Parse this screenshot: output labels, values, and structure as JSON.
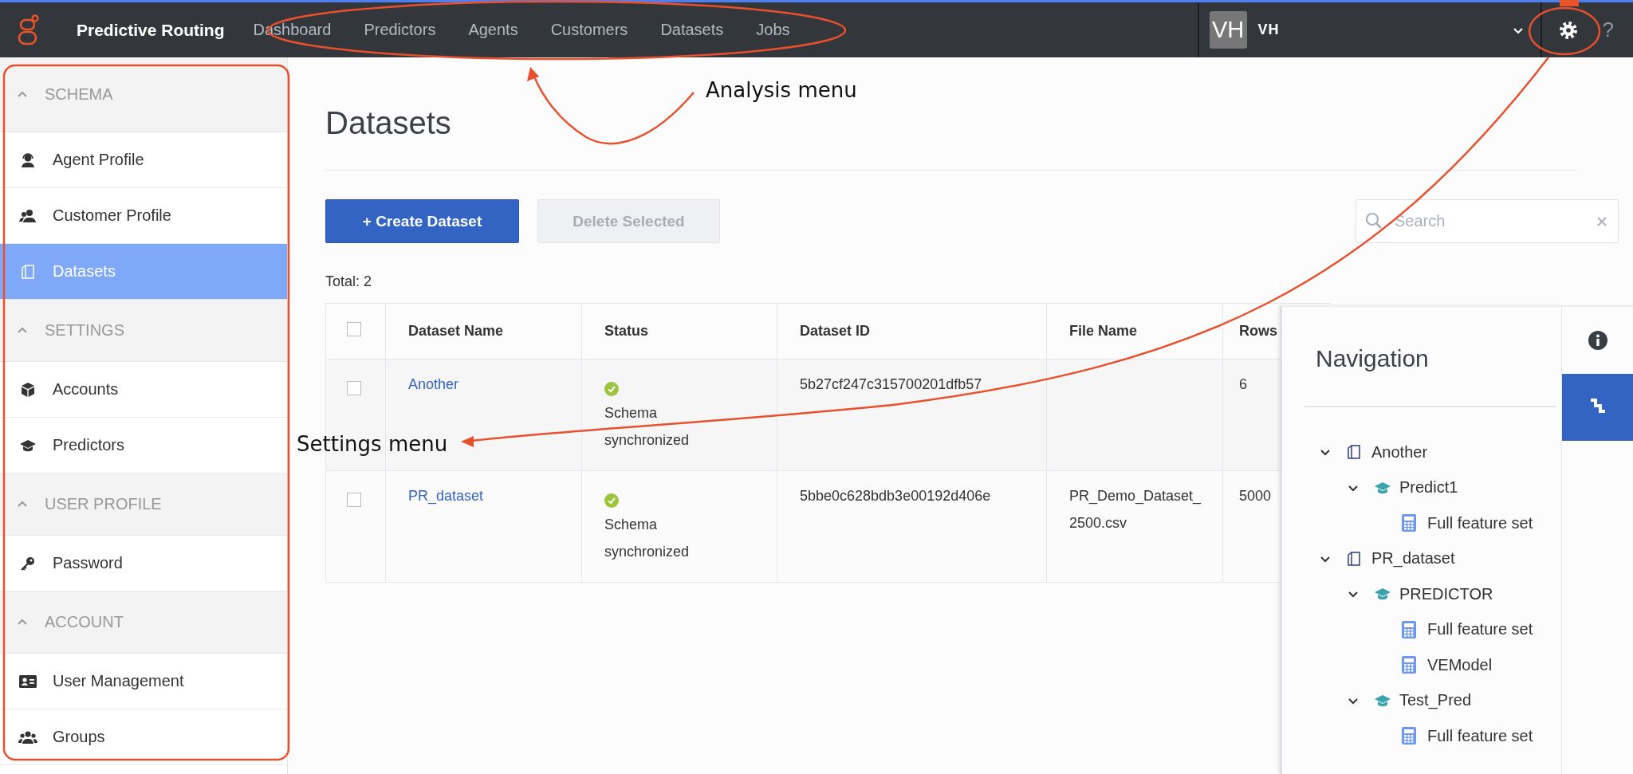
{
  "topbar": {
    "title": "Predictive Routing",
    "nav": [
      {
        "label": "Dashboard"
      },
      {
        "label": "Predictors"
      },
      {
        "label": "Agents"
      },
      {
        "label": "Customers"
      },
      {
        "label": "Datasets"
      },
      {
        "label": "Jobs"
      }
    ],
    "user": {
      "initials": "VH",
      "name": "VH"
    },
    "settings": {
      "selected": true
    },
    "help": "?"
  },
  "sidebar": {
    "sections": [
      {
        "title": "SCHEMA",
        "expanded": true,
        "items": [
          {
            "label": "Agent Profile",
            "kind": "agent",
            "selected": false
          },
          {
            "label": "Customer Profile",
            "kind": "customer",
            "selected": false
          },
          {
            "label": "Datasets",
            "kind": "dataset",
            "selected": true
          }
        ]
      },
      {
        "title": "SETTINGS",
        "expanded": true,
        "items": [
          {
            "label": "Accounts",
            "kind": "account",
            "selected": false
          },
          {
            "label": "Predictors",
            "kind": "predictor",
            "selected": false
          }
        ]
      },
      {
        "title": "USER PROFILE",
        "expanded": true,
        "items": [
          {
            "label": "Password",
            "kind": "password",
            "selected": false
          }
        ]
      },
      {
        "title": "ACCOUNT",
        "expanded": true,
        "items": [
          {
            "label": "User Management",
            "kind": "user-management",
            "selected": false
          },
          {
            "label": "Groups",
            "kind": "groups",
            "selected": false
          }
        ]
      }
    ]
  },
  "page": {
    "title": "Datasets",
    "buttons": [
      {
        "label": "+ Create Dataset",
        "kind": "primary",
        "disabled": false
      },
      {
        "label": "Delete Selected",
        "kind": "secondary",
        "disabled": true
      }
    ],
    "search": {
      "placeholder": "Search"
    },
    "total": "Total: 2"
  },
  "table": {
    "header_checked": false,
    "columns": [
      "Dataset Name",
      "Status",
      "Dataset ID",
      "File Name",
      "Rows"
    ],
    "rows": [
      {
        "checked": false,
        "name": "Another",
        "status": "Schema synchronized",
        "dataset_id": "5b27cf247c315700201dfb57",
        "rows": "6"
      },
      {
        "checked": false,
        "name": "PR_dataset",
        "status": "Schema synchronized",
        "dataset_id": "5bbe0c628bdb3e00192d406e",
        "file_name": "PR_Demo_Dataset_2500.csv",
        "rows": "5000"
      }
    ]
  },
  "navigation": {
    "title": "Navigation",
    "tabs": [
      {
        "kind": "info",
        "selected": false
      },
      {
        "kind": "navigation",
        "selected": true
      }
    ],
    "tree": [
      {
        "label": "Another",
        "kind": "dataset",
        "expanded": true,
        "children": [
          {
            "label": "Predict1",
            "kind": "predictor",
            "expanded": true,
            "children": [
              {
                "label": "Full feature set",
                "kind": "model"
              }
            ]
          }
        ]
      },
      {
        "label": "PR_dataset",
        "kind": "dataset",
        "expanded": true,
        "children": [
          {
            "label": "PREDICTOR",
            "kind": "predictor",
            "expanded": true,
            "children": [
              {
                "label": "Full feature set",
                "kind": "model"
              },
              {
                "label": "VEModel",
                "kind": "model"
              }
            ]
          },
          {
            "label": "Test_Pred",
            "kind": "predictor",
            "expanded": true,
            "children": [
              {
                "label": "Full feature set",
                "kind": "model"
              }
            ]
          }
        ]
      }
    ]
  },
  "annotations": [
    {
      "kind": "ellipse"
    },
    {
      "kind": "ellipse"
    },
    {
      "kind": "frame"
    },
    {
      "kind": "arrow"
    },
    {
      "kind": "arrow"
    },
    {
      "kind": "label",
      "text": "Analysis menu"
    },
    {
      "kind": "label",
      "text": "Settings menu"
    }
  ]
}
